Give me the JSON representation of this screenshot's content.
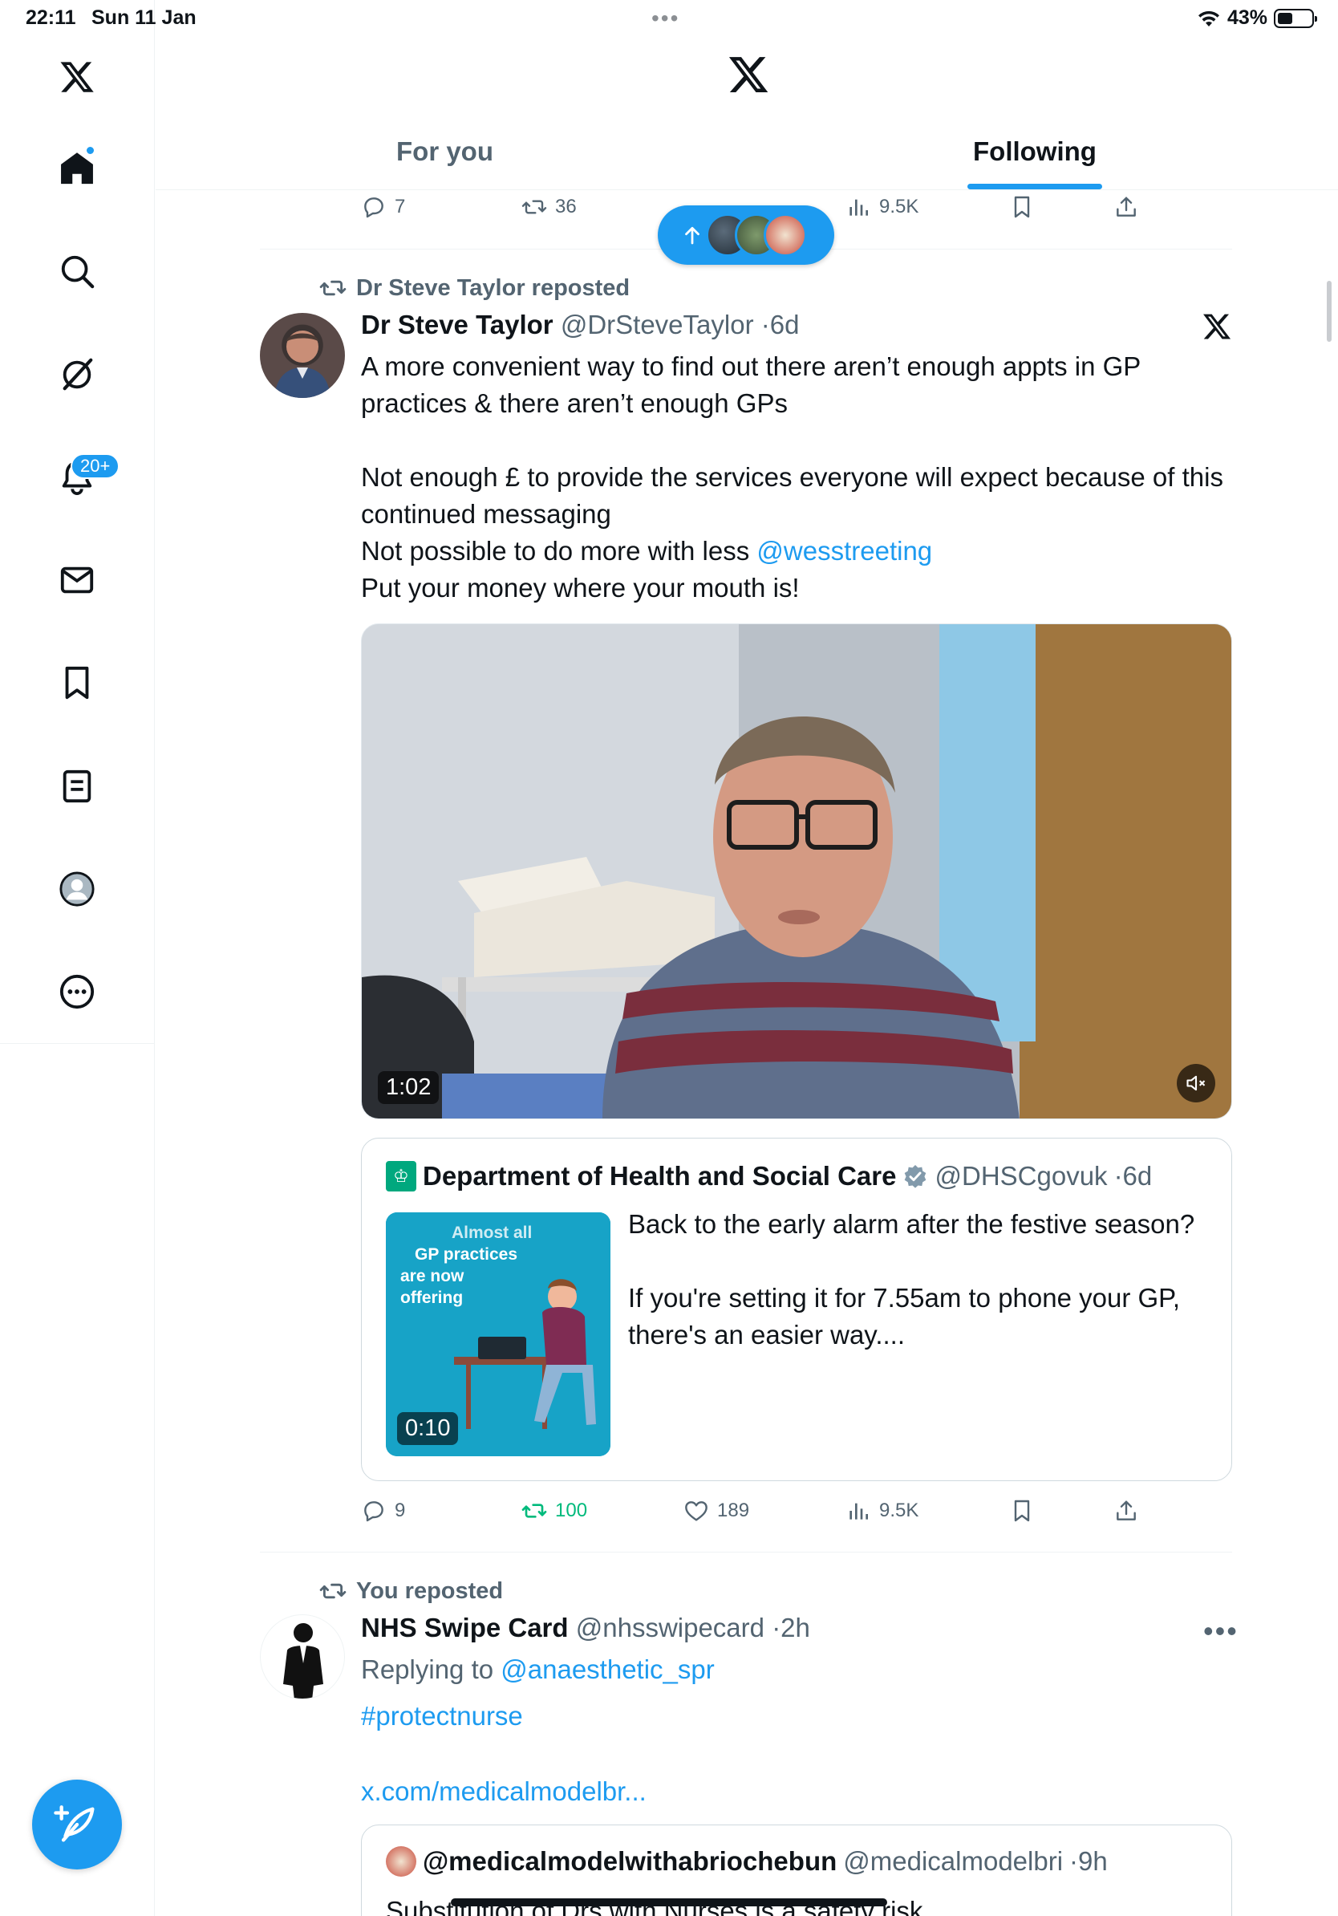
{
  "status_bar": {
    "time": "22:11",
    "date": "Sun 11 Jan",
    "battery": "43%"
  },
  "sidebar": {
    "notifications_badge": "20+",
    "items": [
      "home",
      "explore",
      "grok",
      "notifications",
      "messages",
      "bookmarks",
      "lists",
      "profile",
      "more"
    ]
  },
  "header": {
    "tabs": [
      "For you",
      "Following"
    ],
    "active_tab": "Following"
  },
  "prev_tweet_actions": {
    "replies": "7",
    "reposts": "36",
    "views": "9.5K"
  },
  "tweet1": {
    "repost_label": "Dr Steve Taylor reposted",
    "name": "Dr Steve Taylor",
    "handle": "@DrSteveTaylor",
    "time": "·6d",
    "text_1": "A more convenient way to find out there aren’t enough appts in GP practices & there aren’t enough GPs",
    "text_2": "Not enough £ to provide the services everyone will expect because of this continued messaging",
    "text_3_prefix": "Not possible to do more with less ",
    "text_3_mention": "@wesstreeting",
    "text_4": "Put your money where your mouth is!",
    "video_duration": "1:02",
    "quote": {
      "name": "Department of Health and Social Care",
      "handle": "@DHSCgovuk",
      "time": "·6d",
      "text_1": "Back to the early alarm after the festive season?",
      "text_2": "If you're setting it for 7.55am to phone your GP, there's an easier way....",
      "thumb_title_1": "Almost all",
      "thumb_title_2": "GP practices",
      "thumb_title_3": "are now",
      "thumb_title_4": "offering",
      "video_duration": "0:10"
    },
    "actions": {
      "replies": "9",
      "reposts": "100",
      "likes": "189",
      "views": "9.5K"
    }
  },
  "tweet2": {
    "repost_label": "You reposted",
    "name": "NHS Swipe Card",
    "handle": "@nhsswipecard",
    "time": "·2h",
    "replying_prefix": "Replying to ",
    "replying_to": "@anaesthetic_spr",
    "hashtag": "#protectnurse",
    "url": "x.com/medicalmodelbr...",
    "quote": {
      "name": "@medicalmodelwithabriochebun",
      "handle": "@medicalmodelbri",
      "time": "·9h",
      "text": "Substitution of Drs with Nurses is a safety risk"
    }
  },
  "colors": {
    "accent": "#1d9bf0",
    "repost_green": "#00ba7c",
    "secondary_text": "#536471"
  }
}
